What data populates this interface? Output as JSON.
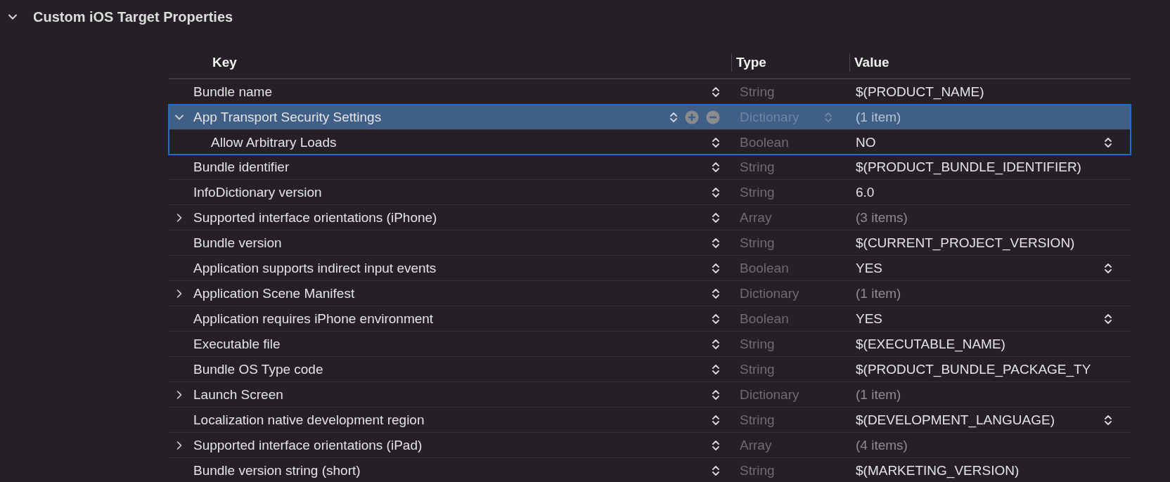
{
  "section": {
    "title": "Custom iOS Target Properties",
    "expanded": true
  },
  "columns": [
    "Key",
    "Type",
    "Value"
  ],
  "rows": [
    {
      "key": "Bundle name",
      "type": "String",
      "value": "$(PRODUCT_NAME)",
      "selected": false
    },
    {
      "key": "App Transport Security Settings",
      "type": "Dictionary",
      "value": "(1 item)",
      "value_dim": true,
      "expanded": true,
      "selected": true,
      "children": [
        {
          "key": "Allow Arbitrary Loads",
          "type": "Boolean",
          "value": "NO",
          "value_popup": true,
          "selected": false
        }
      ]
    },
    {
      "key": "Bundle identifier",
      "type": "String",
      "value": "$(PRODUCT_BUNDLE_IDENTIFIER)",
      "selected": false
    },
    {
      "key": "InfoDictionary version",
      "type": "String",
      "value": "6.0",
      "selected": false
    },
    {
      "key": "Supported interface orientations (iPhone)",
      "type": "Array",
      "value": "(3 items)",
      "value_dim": true,
      "expanded": false,
      "selected": false
    },
    {
      "key": "Bundle version",
      "type": "String",
      "value": "$(CURRENT_PROJECT_VERSION)",
      "selected": false
    },
    {
      "key": "Application supports indirect input events",
      "type": "Boolean",
      "value": "YES",
      "value_popup": true,
      "selected": false
    },
    {
      "key": "Application Scene Manifest",
      "type": "Dictionary",
      "value": "(1 item)",
      "value_dim": true,
      "expanded": false,
      "selected": false
    },
    {
      "key": "Application requires iPhone environment",
      "type": "Boolean",
      "value": "YES",
      "value_popup": true,
      "selected": false
    },
    {
      "key": "Executable file",
      "type": "String",
      "value": "$(EXECUTABLE_NAME)",
      "selected": false
    },
    {
      "key": "Bundle OS Type code",
      "type": "String",
      "value": "$(PRODUCT_BUNDLE_PACKAGE_TY",
      "selected": false
    },
    {
      "key": "Launch Screen",
      "type": "Dictionary",
      "value": "(1 item)",
      "value_dim": true,
      "expanded": false,
      "selected": false
    },
    {
      "key": "Localization native development region",
      "type": "String",
      "value": "$(DEVELOPMENT_LANGUAGE)",
      "value_popup": true,
      "selected": false
    },
    {
      "key": "Supported interface orientations (iPad)",
      "type": "Array",
      "value": "(4 items)",
      "value_dim": true,
      "expanded": false,
      "selected": false
    },
    {
      "key": "Bundle version string (short)",
      "type": "String",
      "value": "$(MARKETING_VERSION)",
      "selected": false
    }
  ]
}
